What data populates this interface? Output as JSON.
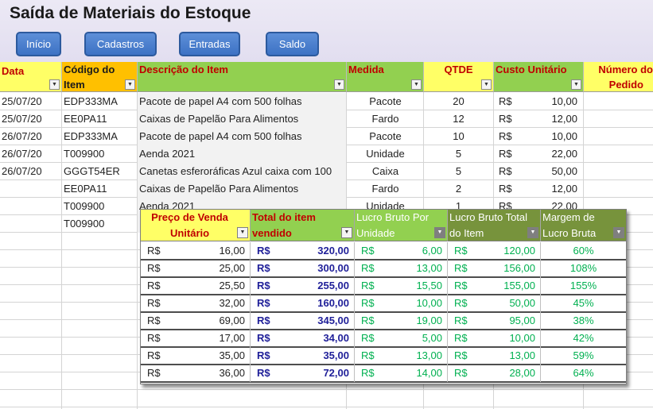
{
  "title": "Saída de Materiais do Estoque",
  "nav": {
    "inicio": "Início",
    "cadastros": "Cadastros",
    "entradas": "Entradas",
    "saldo": "Saldo"
  },
  "headers": {
    "data": "Data",
    "codigo_l1": "Código do",
    "codigo_l2": "Item",
    "descricao": "Descrição do Item",
    "medida": "Medida",
    "qtde": "QTDE",
    "custo": "Custo Unitário",
    "pedido_l1": "Número do",
    "pedido_l2": "Pedido"
  },
  "rows": [
    {
      "data": "25/07/20",
      "codigo": "EDP333MA",
      "descricao": "Pacote de papel A4 com 500 folhas",
      "medida": "Pacote",
      "qtde": "20",
      "rs": "R$",
      "custo": "10,00"
    },
    {
      "data": "25/07/20",
      "codigo": "EE0PA11",
      "descricao": "Caixas de Papelão Para Alimentos",
      "medida": "Fardo",
      "qtde": "12",
      "rs": "R$",
      "custo": "12,00"
    },
    {
      "data": "26/07/20",
      "codigo": "EDP333MA",
      "descricao": "Pacote de papel A4 com 500 folhas",
      "medida": "Pacote",
      "qtde": "10",
      "rs": "R$",
      "custo": "10,00"
    },
    {
      "data": "26/07/20",
      "codigo": "T009900",
      "descricao": "Aenda 2021",
      "medida": "Unidade",
      "qtde": "5",
      "rs": "R$",
      "custo": "22,00"
    },
    {
      "data": "26/07/20",
      "codigo": "GGGT54ER",
      "descricao": "Canetas esferoráficas Azul caixa com 100",
      "medida": "Caixa",
      "qtde": "5",
      "rs": "R$",
      "custo": "50,00"
    },
    {
      "data": "",
      "codigo": "EE0PA11",
      "descricao": "Caixas de Papelão Para Alimentos",
      "medida": "Fardo",
      "qtde": "2",
      "rs": "R$",
      "custo": "12,00"
    },
    {
      "data": "",
      "codigo": "T009900",
      "descricao": "Aenda 2021",
      "medida": "Unidade",
      "qtde": "1",
      "rs": "R$",
      "custo": "22,00"
    },
    {
      "data": "",
      "codigo": "T009900",
      "descricao": "",
      "medida": "",
      "qtde": "",
      "rs": "",
      "custo": ""
    }
  ],
  "overlay": {
    "headers": {
      "preco_l1": "Preço de Venda",
      "preco_l2": "Unitário",
      "total_l1": "Total do item",
      "total_l2": "vendido",
      "lucro_un_l1": "Lucro Bruto Por",
      "lucro_un_l2": "Unidade",
      "lucro_tot_l1": "Lucro Bruto Total",
      "lucro_tot_l2": "do Item",
      "margem_l1": "Margem de",
      "margem_l2": "Lucro Bruta"
    },
    "currency": "R$",
    "rows": [
      {
        "preco": "16,00",
        "total": "320,00",
        "lucro_un": "6,00",
        "lucro_tot": "120,00",
        "margem": "60%"
      },
      {
        "preco": "25,00",
        "total": "300,00",
        "lucro_un": "13,00",
        "lucro_tot": "156,00",
        "margem": "108%"
      },
      {
        "preco": "25,50",
        "total": "255,00",
        "lucro_un": "15,50",
        "lucro_tot": "155,00",
        "margem": "155%"
      },
      {
        "preco": "32,00",
        "total": "160,00",
        "lucro_un": "10,00",
        "lucro_tot": "50,00",
        "margem": "45%"
      },
      {
        "preco": "69,00",
        "total": "345,00",
        "lucro_un": "19,00",
        "lucro_tot": "95,00",
        "margem": "38%"
      },
      {
        "preco": "17,00",
        "total": "34,00",
        "lucro_un": "5,00",
        "lucro_tot": "10,00",
        "margem": "42%"
      },
      {
        "preco": "35,00",
        "total": "35,00",
        "lucro_un": "13,00",
        "lucro_tot": "13,00",
        "margem": "59%"
      },
      {
        "preco": "36,00",
        "total": "72,00",
        "lucro_un": "14,00",
        "lucro_tot": "28,00",
        "margem": "64%"
      }
    ]
  },
  "colors": {
    "header_yellow": "#ffff66",
    "header_orange": "#ffc000",
    "header_green": "#92d050",
    "header_olive": "#77933c",
    "red_text": "#c00000",
    "navy_text": "#1f1f99",
    "green_text": "#00b050"
  }
}
